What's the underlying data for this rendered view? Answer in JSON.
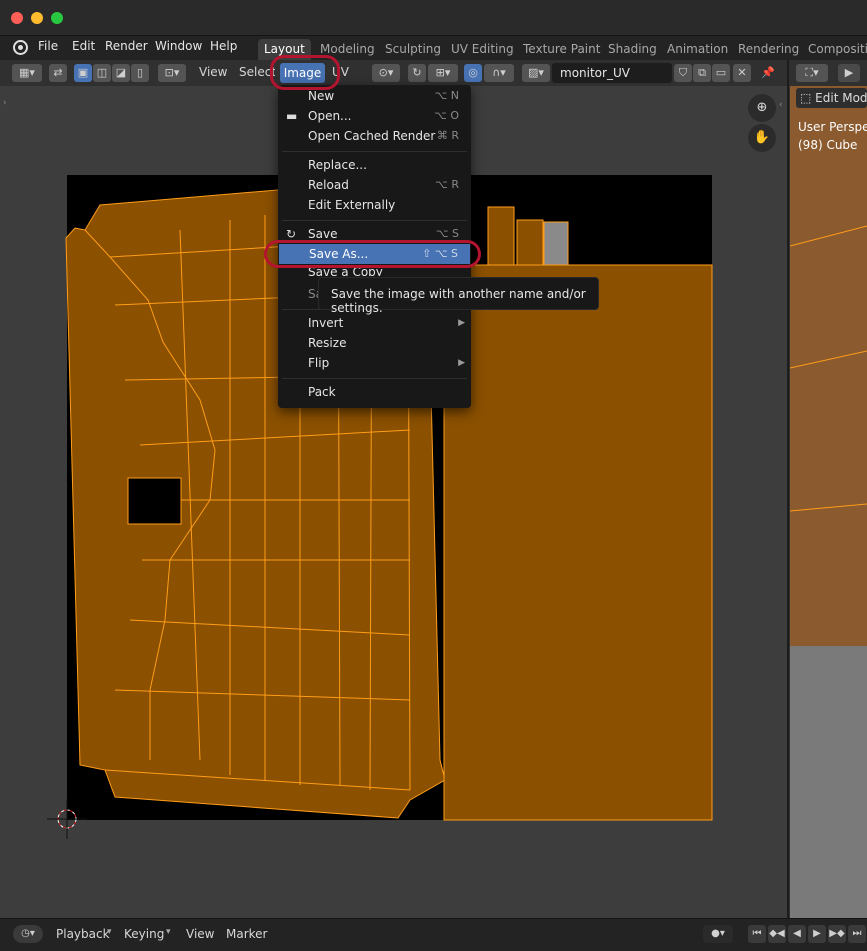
{
  "menubar": {
    "items": [
      "File",
      "Edit",
      "Render",
      "Window",
      "Help"
    ],
    "workspaces": [
      "Layout",
      "Modeling",
      "Sculpting",
      "UV Editing",
      "Texture Paint",
      "Shading",
      "Animation",
      "Rendering",
      "Compositing"
    ],
    "active_workspace": "Layout"
  },
  "uv_header": {
    "view": "View",
    "select": "Select",
    "image": "Image",
    "uv": "UV",
    "image_name": "monitor_UV"
  },
  "image_menu": {
    "items": [
      {
        "label": "New",
        "shortcut": "⌥ N"
      },
      {
        "label": "Open...",
        "shortcut": "⌥ O"
      },
      {
        "label": "Open Cached Render",
        "shortcut": "⌘ R"
      },
      {
        "label": "Replace...",
        "shortcut": ""
      },
      {
        "label": "Reload",
        "shortcut": "⌥ R"
      },
      {
        "label": "Edit Externally",
        "shortcut": ""
      },
      {
        "label": "Save",
        "shortcut": "⌥ S"
      },
      {
        "label": "Save As...",
        "shortcut": "⇧ ⌥ S"
      },
      {
        "label": "Save a Copy",
        "shortcut": ""
      },
      {
        "label": "Save All Images",
        "shortcut": ""
      },
      {
        "label": "Invert",
        "shortcut": ""
      },
      {
        "label": "Resize",
        "shortcut": ""
      },
      {
        "label": "Flip",
        "shortcut": ""
      },
      {
        "label": "Pack",
        "shortcut": ""
      }
    ],
    "highlighted": "Save As..."
  },
  "tooltip": {
    "text": "Save the image with another name and/or settings."
  },
  "viewport3d": {
    "mode": "Edit Mode",
    "view_name": "User Perspective",
    "object": "(98) Cube"
  },
  "timeline": {
    "playback": "Playback",
    "keying": "Keying",
    "view": "View",
    "marker": "Marker"
  },
  "colors": {
    "uv_fill": "#8b5000",
    "uv_edge": "#ff9d1a",
    "highlight_blue": "#4772b3",
    "annotation_red": "#b3142e"
  }
}
